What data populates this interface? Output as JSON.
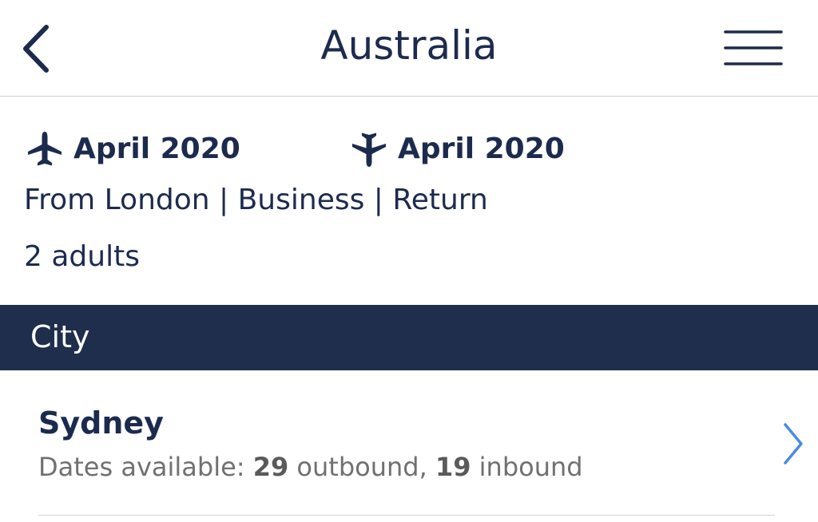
{
  "header": {
    "title": "Australia",
    "back_icon": "chevron-left-icon",
    "menu_icon": "hamburger-menu-icon"
  },
  "summary": {
    "outbound": {
      "icon": "plane-departure-icon",
      "date": "April 2020"
    },
    "inbound": {
      "icon": "plane-arrival-icon",
      "date": "April 2020"
    },
    "trip": "From London | Business | Return",
    "passengers": "2 adults"
  },
  "section": {
    "label": "City"
  },
  "cities": [
    {
      "name": "Sydney",
      "dates_prefix": "Dates available: ",
      "outbound_count": "29",
      "outbound_label": " outbound, ",
      "inbound_count": "19",
      "inbound_label": " inbound",
      "chevron_icon": "chevron-right-icon"
    }
  ],
  "colors": {
    "primary": "#1c2b4d",
    "section_bg": "#1f2e4c",
    "chevron": "#4a8ae8",
    "muted_text": "#707070"
  }
}
